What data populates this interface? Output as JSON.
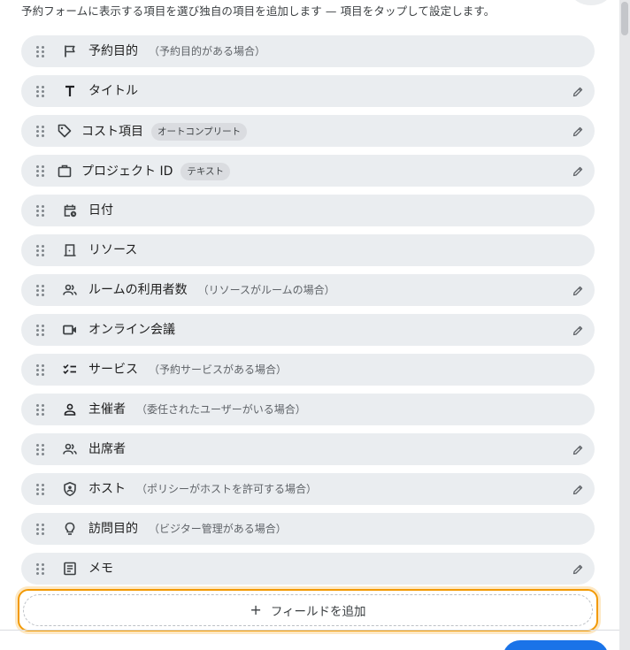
{
  "description": "予約フォームに表示する項目を選び独自の項目を追加します — 項目をタップして設定します。",
  "fields": [
    {
      "label": "予約目的",
      "note": "（予約目的がある場合）",
      "tag": "",
      "icon": "flag-icon",
      "editable": false
    },
    {
      "label": "タイトル",
      "note": "",
      "tag": "",
      "icon": "title-icon",
      "editable": true
    },
    {
      "label": "コスト項目",
      "note": "",
      "tag": "オートコンプリート",
      "icon": "tag-icon",
      "editable": true
    },
    {
      "label": "プロジェクト ID",
      "note": "",
      "tag": "テキスト",
      "icon": "briefcase-icon",
      "editable": true
    },
    {
      "label": "日付",
      "note": "",
      "tag": "",
      "icon": "calendar-clock-icon",
      "editable": false
    },
    {
      "label": "リソース",
      "note": "",
      "tag": "",
      "icon": "door-icon",
      "editable": false
    },
    {
      "label": "ルームの利用者数",
      "note": "（リソースがルームの場合）",
      "tag": "",
      "icon": "people-icon",
      "editable": true
    },
    {
      "label": "オンライン会議",
      "note": "",
      "tag": "",
      "icon": "video-icon",
      "editable": true
    },
    {
      "label": "サービス",
      "note": "（予約サービスがある場合）",
      "tag": "",
      "icon": "checklist-icon",
      "editable": false
    },
    {
      "label": "主催者",
      "note": "（委任されたユーザーがいる場合）",
      "tag": "",
      "icon": "person-icon",
      "editable": false
    },
    {
      "label": "出席者",
      "note": "",
      "tag": "",
      "icon": "people-icon",
      "editable": true
    },
    {
      "label": "ホスト",
      "note": "（ポリシーがホストを許可する場合）",
      "tag": "",
      "icon": "shield-person-icon",
      "editable": true
    },
    {
      "label": "訪問目的",
      "note": "（ビジター管理がある場合）",
      "tag": "",
      "icon": "lightbulb-icon",
      "editable": false
    },
    {
      "label": "メモ",
      "note": "",
      "tag": "",
      "icon": "notes-icon",
      "editable": true
    }
  ],
  "add_field": {
    "plus": "+",
    "label": "フィールドを追加"
  },
  "colors": {
    "accent": "#1a73e8",
    "focus_ring": "#f29900",
    "row_bg": "#eaedf0"
  }
}
